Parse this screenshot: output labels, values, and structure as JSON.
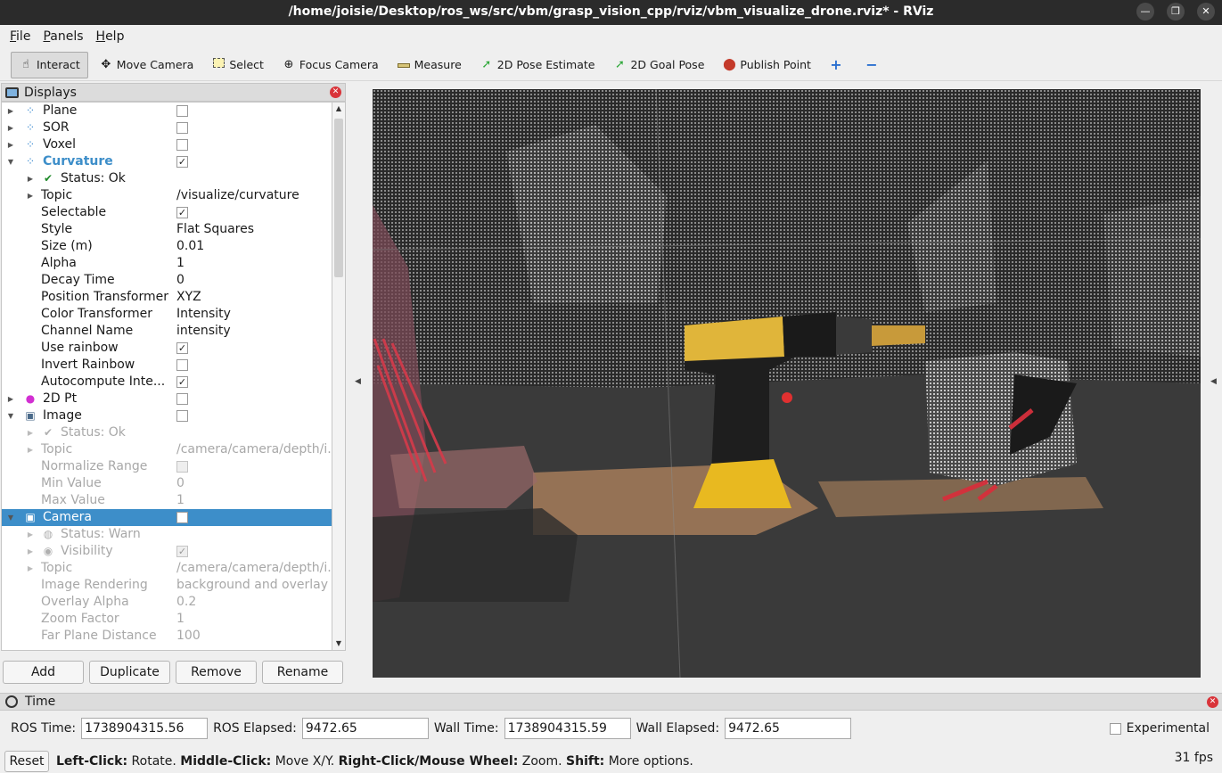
{
  "window": {
    "title": "/home/joisie/Desktop/ros_ws/src/vbm/grasp_vision_cpp/rviz/vbm_visualize_drone.rviz* - RViz"
  },
  "menu": [
    {
      "label": "File",
      "underline": "F",
      "rest": "ile"
    },
    {
      "label": "Panels",
      "underline": "P",
      "rest": "anels"
    },
    {
      "label": "Help",
      "underline": "H",
      "rest": "elp"
    }
  ],
  "toolbar": {
    "tools": [
      {
        "label": "Interact",
        "icon": "hand-icon",
        "active": true
      },
      {
        "label": "Move Camera",
        "icon": "move-camera-icon"
      },
      {
        "label": "Select",
        "icon": "select-box-icon"
      },
      {
        "label": "Focus Camera",
        "icon": "crosshair-icon"
      },
      {
        "label": "Measure",
        "icon": "ruler-icon"
      },
      {
        "label": "2D Pose Estimate",
        "icon": "green-arrow-icon"
      },
      {
        "label": "2D Goal Pose",
        "icon": "green-arrow-icon"
      },
      {
        "label": "Publish Point",
        "icon": "map-pin-icon"
      }
    ]
  },
  "displays": {
    "title": "Displays",
    "rows": [
      {
        "label": "Plane",
        "level": 0,
        "expander": "collapsed",
        "icon": "pointcloud-icon",
        "check": false
      },
      {
        "label": "SOR",
        "level": 0,
        "expander": "collapsed",
        "icon": "pointcloud-icon",
        "check": false
      },
      {
        "label": "Voxel",
        "level": 0,
        "expander": "collapsed",
        "icon": "pointcloud-icon",
        "check": false
      },
      {
        "label": "Curvature",
        "level": 0,
        "expander": "expanded",
        "icon": "pointcloud-icon",
        "check": true,
        "highlight": true
      },
      {
        "label": "Status: Ok",
        "level": 1,
        "expander": "collapsed",
        "icon": "checkmark-icon"
      },
      {
        "label": "Topic",
        "level": 1,
        "expander": "collapsed",
        "value": "/visualize/curvature"
      },
      {
        "label": "Selectable",
        "level": 1,
        "check": true
      },
      {
        "label": "Style",
        "level": 1,
        "value": "Flat Squares"
      },
      {
        "label": "Size (m)",
        "level": 1,
        "value": "0.01"
      },
      {
        "label": "Alpha",
        "level": 1,
        "value": "1"
      },
      {
        "label": "Decay Time",
        "level": 1,
        "value": "0"
      },
      {
        "label": "Position Transformer",
        "level": 1,
        "value": "XYZ"
      },
      {
        "label": "Color Transformer",
        "level": 1,
        "value": "Intensity"
      },
      {
        "label": "Channel Name",
        "level": 1,
        "value": "intensity"
      },
      {
        "label": "Use rainbow",
        "level": 1,
        "check": true
      },
      {
        "label": "Invert Rainbow",
        "level": 1,
        "check": false
      },
      {
        "label": "Autocompute Inte...",
        "level": 1,
        "check": true
      },
      {
        "label": "2D Pt",
        "level": 0,
        "expander": "collapsed",
        "icon": "magenta-dot-icon",
        "check": false
      },
      {
        "label": "Image",
        "level": 0,
        "expander": "expanded",
        "icon": "image-icon",
        "check": false
      },
      {
        "label": "Status: Ok",
        "level": 1,
        "expander": "collapsed",
        "icon": "checkmark-icon",
        "disabled": true
      },
      {
        "label": "Topic",
        "level": 1,
        "expander": "collapsed",
        "value": "/camera/camera/depth/i...",
        "disabled": true
      },
      {
        "label": "Normalize Range",
        "level": 1,
        "check": false,
        "disabled": true
      },
      {
        "label": "Min Value",
        "level": 1,
        "value": "0",
        "disabled": true
      },
      {
        "label": "Max Value",
        "level": 1,
        "value": "1",
        "disabled": true
      },
      {
        "label": "Camera",
        "level": 0,
        "expander": "expanded",
        "icon": "camera-icon",
        "check": false,
        "selected": true
      },
      {
        "label": "Status: Warn",
        "level": 1,
        "expander": "collapsed",
        "icon": "warning-icon",
        "disabled": true
      },
      {
        "label": "Visibility",
        "level": 1,
        "expander": "collapsed",
        "icon": "eye-icon",
        "check": true,
        "disabled": true
      },
      {
        "label": "Topic",
        "level": 1,
        "expander": "collapsed",
        "value": "/camera/camera/depth/i...",
        "disabled": true
      },
      {
        "label": "Image Rendering",
        "level": 1,
        "value": "background and overlay",
        "disabled": true
      },
      {
        "label": "Overlay Alpha",
        "level": 1,
        "value": "0.2",
        "disabled": true
      },
      {
        "label": "Zoom Factor",
        "level": 1,
        "value": "1",
        "disabled": true
      },
      {
        "label": "Far Plane Distance",
        "level": 1,
        "value": "100",
        "disabled": true
      }
    ],
    "buttons": [
      "Add",
      "Duplicate",
      "Remove",
      "Rename"
    ]
  },
  "time": {
    "title": "Time",
    "ros_time_label": "ROS Time:",
    "ros_time": "1738904315.56",
    "ros_elapsed_label": "ROS Elapsed:",
    "ros_elapsed": "9472.65",
    "wall_time_label": "Wall Time:",
    "wall_time": "1738904315.59",
    "wall_elapsed_label": "Wall Elapsed:",
    "wall_elapsed": "9472.65",
    "experimental_label": "Experimental"
  },
  "status": {
    "reset": "Reset",
    "left_click": "Left-Click:",
    "left_click_desc": " Rotate. ",
    "middle_click": "Middle-Click:",
    "middle_click_desc": " Move X/Y. ",
    "right_click": "Right-Click/Mouse Wheel:",
    "right_click_desc": " Zoom. ",
    "shift": "Shift:",
    "shift_desc": " More options.",
    "fps": "31 fps"
  },
  "colors": {
    "selection": "#3d8ec9",
    "highlight_text": "#3d8ec9",
    "titlebar": "#2b2b2b",
    "viewport_bg": "#3a3a3a"
  }
}
